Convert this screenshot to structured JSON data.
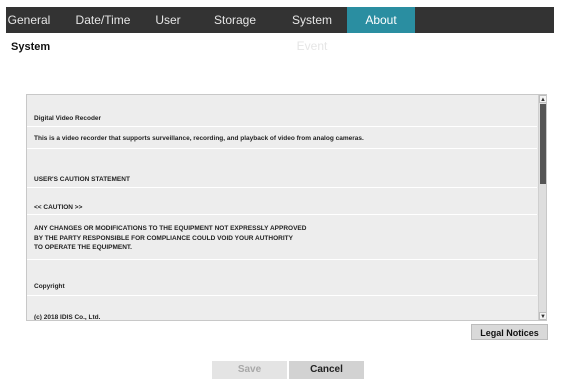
{
  "tabs": [
    {
      "label": "General"
    },
    {
      "label": "Date/Time"
    },
    {
      "label": "User"
    },
    {
      "label": "Storage"
    },
    {
      "label": "System Event"
    },
    {
      "label": "About",
      "active": true
    }
  ],
  "section_title": "System",
  "content": {
    "heading1": "Digital Video Recoder",
    "desc": "This is a video recorder that supports surveillance, recording, and playback of video from analog cameras.",
    "heading2": "USER'S CAUTION STATEMENT",
    "caution_title": "<< CAUTION >>",
    "caution_lines": [
      "ANY CHANGES OR MODIFICATIONS TO THE EQUIPMENT NOT EXPRESSLY APPROVED",
      "BY THE PARTY RESPONSIBLE FOR COMPLIANCE COULD VOID YOUR AUTHORITY",
      "TO OPERATE THE EQUIPMENT."
    ],
    "heading3": "Copyright",
    "copyright": "(c) 2018 IDIS Co., Ltd."
  },
  "scrollbar": {
    "up": "▲",
    "down": "▼"
  },
  "legal_notices_label": "Legal Notices",
  "buttons": {
    "save": "Save",
    "cancel": "Cancel"
  },
  "colors": {
    "tab_bar": "#333333",
    "active_tab": "#2a8ea1"
  }
}
